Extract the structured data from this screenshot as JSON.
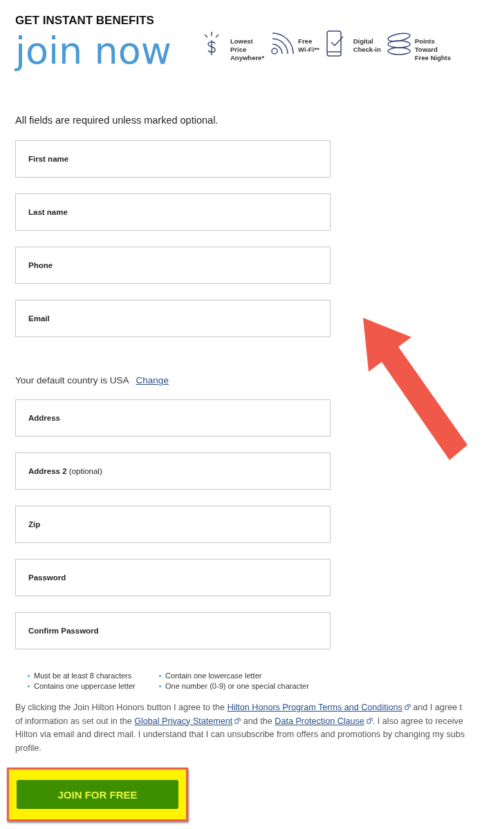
{
  "header": {
    "eyebrow": "GET INSTANT BENEFITS",
    "headline": "join now",
    "benefits": [
      {
        "kind": "dollar",
        "lines": [
          "Lowest",
          "Price",
          "Anywhere*"
        ]
      },
      {
        "kind": "wifi",
        "lines": [
          "Free",
          "Wi-Fi**"
        ]
      },
      {
        "kind": "phone",
        "lines": [
          "Digital",
          "Check-in"
        ]
      },
      {
        "kind": "coins",
        "lines": [
          "Points",
          "Toward",
          "Free Nights"
        ]
      }
    ]
  },
  "intro": "All fields are required unless marked optional.",
  "fields_top": [
    {
      "label": "First name"
    },
    {
      "label": "Last name"
    },
    {
      "label": "Phone"
    },
    {
      "label": "Email"
    }
  ],
  "country": {
    "text": "Your default country is USA",
    "link": "Change"
  },
  "fields_bottom": [
    {
      "label": "Address"
    },
    {
      "label": "Address 2",
      "note": "(optional)"
    },
    {
      "label": "Zip"
    },
    {
      "label": "Password"
    },
    {
      "label": "Confirm Password"
    }
  ],
  "password_rules": [
    "Must be at least 8 characters",
    "Contain one lowercase letter",
    "Contains one uppercase letter",
    "One number (0-9) or one special character"
  ],
  "legal": [
    [
      {
        "t": "By clicking the Join Hilton Honors button I agree to the "
      },
      {
        "t": "Hilton Honors Program Terms and Conditions",
        "link": true
      },
      {
        "t": " and I agree t"
      }
    ],
    [
      {
        "t": "of information as set out in the "
      },
      {
        "t": "Global Privacy Statement",
        "link": true
      },
      {
        "t": " and the "
      },
      {
        "t": "Data Protection Clause",
        "link": true
      },
      {
        "t": ". I also agree to receive"
      }
    ],
    [
      {
        "t": "Hilton via email and direct mail. I understand that I can unsubscribe from offers and promotions by changing my subs"
      }
    ],
    [
      {
        "t": "profile."
      }
    ]
  ],
  "submit": "JOIN FOR FREE"
}
